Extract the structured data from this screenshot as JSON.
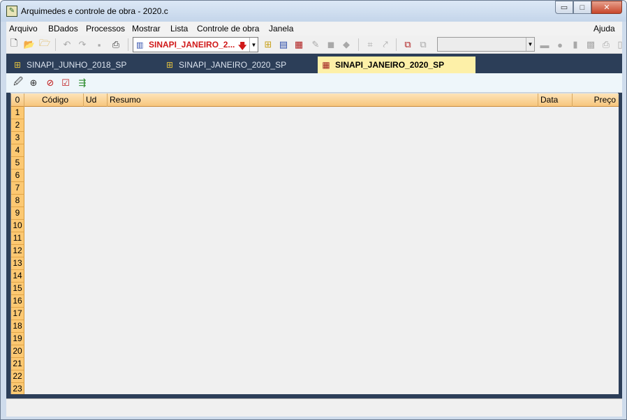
{
  "window": {
    "title": "Arquimedes e controle de obra - 2020.c",
    "controls": {
      "minimize": "▭",
      "maximize": "□",
      "close": "✕"
    }
  },
  "menu": {
    "items": [
      "Arquivo",
      "BDados",
      "Processos",
      "Mostrar",
      "Lista",
      "Controle de obra",
      "Janela"
    ],
    "help": "Ajuda"
  },
  "toolbar": {
    "db_selector": {
      "value": "SINAPI_JANEIRO_2...",
      "icon": "books-icon"
    },
    "secondary_selector": {
      "value": ""
    }
  },
  "tabs": [
    {
      "label": "SINAPI_JUNHO_2018_SP",
      "icon": "add-db-icon",
      "active": false
    },
    {
      "label": "SINAPI_JANEIRO_2020_SP",
      "icon": "add-db-icon",
      "active": false
    },
    {
      "label": "SINAPI_JANEIRO_2020_SP",
      "icon": "document-list-icon",
      "active": true
    }
  ],
  "grid": {
    "corner": "0",
    "columns": [
      "Código",
      "Ud",
      "Resumo",
      "Data",
      "Preço"
    ],
    "row_numbers": [
      "1",
      "2",
      "3",
      "4",
      "5",
      "6",
      "7",
      "8",
      "9",
      "10",
      "11",
      "12",
      "13",
      "14",
      "15",
      "16",
      "17",
      "18",
      "19",
      "20",
      "21",
      "22",
      "23"
    ]
  },
  "colors": {
    "accent_header": "#f7c67e",
    "tab_strip": "#2c3e58",
    "active_tab": "#fdf0a8",
    "db_text": "#d01818"
  }
}
